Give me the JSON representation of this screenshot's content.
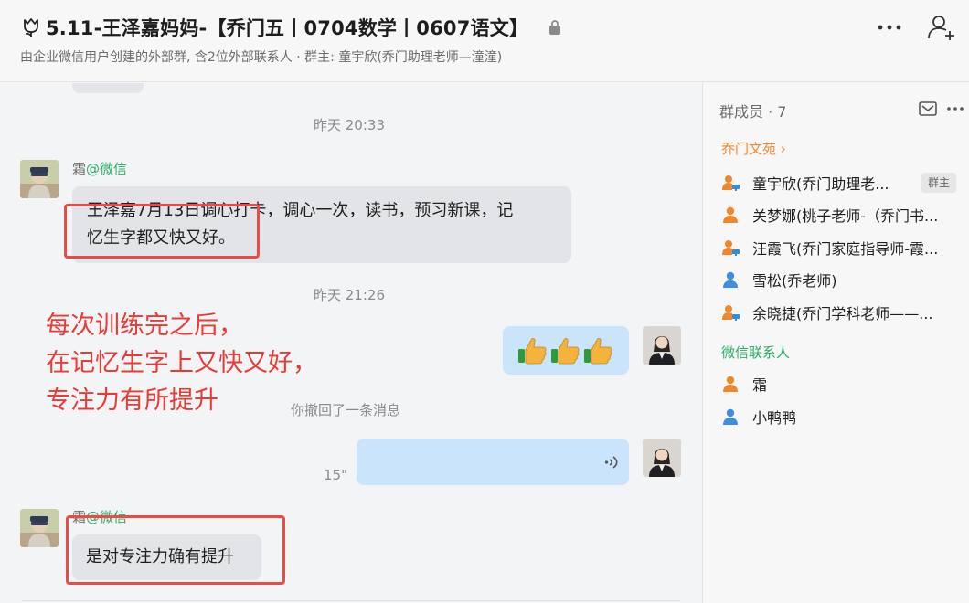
{
  "header": {
    "title": "5.11-王泽嘉妈妈-【乔门五丨0704数学丨0607语文】",
    "subtitle": "由企业微信用户创建的外部群, 含2位外部联系人 · 群主: 童宇欣(乔门助理老师—潼潼)"
  },
  "chat": {
    "messages": [
      {
        "type": "timestamp",
        "text": "昨天 20:33"
      },
      {
        "type": "incoming",
        "sender": "霜",
        "sender_suffix": "@微信",
        "text_line1": "王泽嘉7月13日调心打卡，调心一次，读书，预习新课，记",
        "text_line2": "忆生字都又快又好。"
      },
      {
        "type": "timestamp",
        "text": "昨天 21:26"
      },
      {
        "type": "outgoing",
        "emoji": "👍👍👍"
      },
      {
        "type": "system",
        "text": "你撤回了一条消息"
      },
      {
        "type": "outgoing-voice",
        "duration": "15\""
      },
      {
        "type": "incoming",
        "sender": "霜",
        "sender_suffix": "@微信",
        "text": "是对专注力确有提升"
      }
    ],
    "annotation": {
      "line1": "每次训练完之后，",
      "line2": "在记忆生字上又快又好，",
      "line3": "专注力有所提升",
      "color": "#ea3a36"
    }
  },
  "side_panel": {
    "members_header": "群成员 · 7",
    "sections": [
      {
        "name": "乔门文苑",
        "chevron": "›",
        "members": [
          {
            "name": "童宇欣(乔门助理老...",
            "badge": "群主",
            "icon": "person-with-screen-icon"
          },
          {
            "name": "关梦娜(桃子老师-（乔门书...",
            "icon": "person-orange-icon"
          },
          {
            "name": "汪霞飞(乔门家庭指导师-霞...",
            "icon": "person-with-screen-icon"
          },
          {
            "name": "雪松(乔老师)",
            "icon": "person-blue-icon"
          },
          {
            "name": "余晓捷(乔门学科老师——...",
            "icon": "person-with-screen-icon"
          }
        ]
      },
      {
        "name": "微信联系人",
        "members": [
          {
            "name": "霜",
            "icon": "person-orange-icon"
          },
          {
            "name": "小鸭鸭",
            "icon": "person-blue-icon"
          }
        ]
      }
    ]
  },
  "colors": {
    "accent_orange": "#f0872c",
    "wechat_green": "#2aae67",
    "bubble_out": "#c9e4fb",
    "bubble_in": "#e2e4e8",
    "highlight_red": "#ea4a48"
  }
}
